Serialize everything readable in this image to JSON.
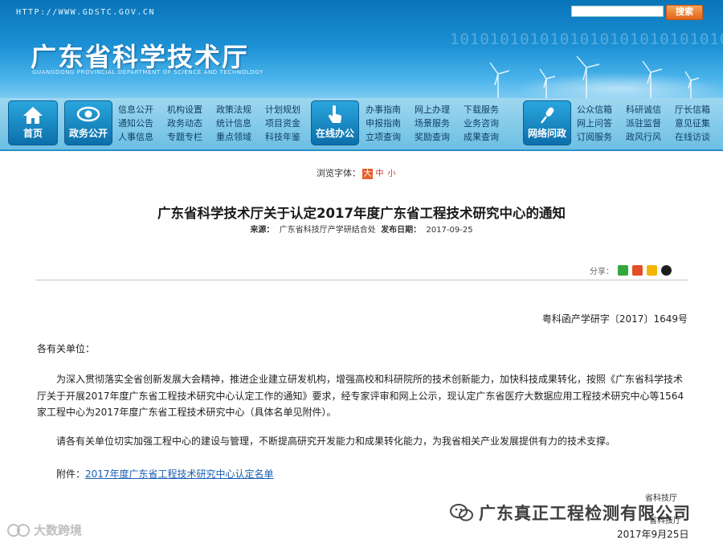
{
  "banner": {
    "url": "HTTP://WWW.GDSTC.GOV.CN",
    "title": "广东省科学技术厅",
    "subtitle": "GUANGDONG PROVINCIAL DEPARTMENT OF SCIENCE AND TECHNOLOGY",
    "binary": "1010101010101010101010101010",
    "search_button": "搜索"
  },
  "nav": {
    "home": "首页",
    "zhengwu": {
      "label": "政务公开",
      "links": [
        "信息公开",
        "机构设置",
        "政策法规",
        "计划规划",
        "通知公告",
        "政务动态",
        "统计信息",
        "项目资金",
        "人事信息",
        "专题专栏",
        "重点领域",
        "科技年鉴"
      ]
    },
    "online": {
      "label": "在线办公",
      "links": [
        "办事指南",
        "网上办理",
        "下载服务",
        "申报指南",
        "场景服务",
        "业务咨询",
        "立项查询",
        "奖励查询",
        "成果查询"
      ]
    },
    "wenzheng": {
      "label": "网络问政",
      "links": [
        "公众信箱",
        "科研诚信",
        "厅长信箱",
        "网上问答",
        "派驻监督",
        "意见征集",
        "订阅服务",
        "政风行风",
        "在线访谈"
      ]
    }
  },
  "content": {
    "font_label": "浏览字体：",
    "font_sizes": [
      "大",
      "中",
      "小"
    ],
    "title": "广东省科学技术厅关于认定2017年度广东省工程技术研究中心的通知",
    "meta_source_label": "来源：",
    "meta_source": "广东省科技厅产学研结合处",
    "meta_date_label": "发布日期：",
    "meta_date": "2017-09-25",
    "share_label": "分享：",
    "doc_no": "粤科函产学研字〔2017〕1649号",
    "greeting": "各有关单位：",
    "para1": "为深入贯彻落实全省创新发展大会精神，推进企业建立研发机构，增强高校和科研院所的技术创新能力，加快科技成果转化，按照《广东省科学技术厅关于开展2017年度广东省工程技术研究中心认定工作的通知》要求，经专家评审和网上公示，现认定广东省医疗大数据应用工程技术研究中心等1564家工程中心为2017年度广东省工程技术研究中心（具体名单见附件）。",
    "para2": "请各有关单位切实加强工程中心的建设与管理，不断提高研究开发能力和成果转化能力，为我省相关产业发展提供有力的技术支撑。",
    "attach_label": "附件：",
    "attach_link": "2017年度广东省工程技术研究中心认定名单",
    "sign": "省科技厅",
    "sign2": "省科技厅",
    "date": "2017年9月25日"
  },
  "watermarks": {
    "right": "广东真正工程检测有限公司",
    "left": "大数跨境"
  },
  "colors": {
    "banner_blue": "#1a8fd3",
    "nav_button": "#0c6faa",
    "link": "#1a5fb4",
    "search_orange": "#e0661b"
  }
}
